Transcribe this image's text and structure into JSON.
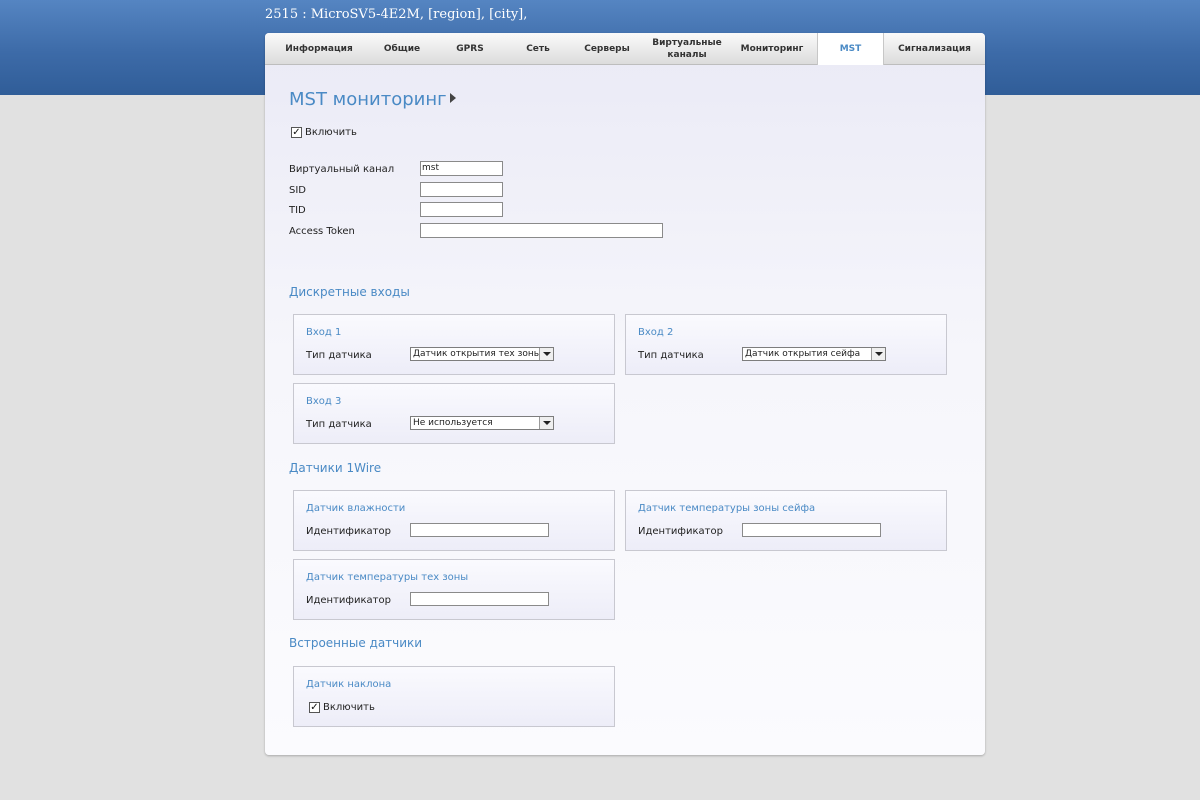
{
  "header": {
    "device_title": "2515 : MicroSV5-4E2M, [region], [city],"
  },
  "tabs": [
    {
      "label": "Информация",
      "active": false
    },
    {
      "label": "Общие",
      "active": false
    },
    {
      "label": "GPRS",
      "active": false
    },
    {
      "label": "Сеть",
      "active": false
    },
    {
      "label": "Серверы",
      "active": false
    },
    {
      "label": "Виртуальные каналы",
      "active": false
    },
    {
      "label": "Мониторинг",
      "active": false
    },
    {
      "label": "MST",
      "active": true
    },
    {
      "label": "Сигнализация",
      "active": false
    }
  ],
  "page": {
    "title": "MST мониторинг",
    "enable_label": "Включить",
    "enable_checked": true
  },
  "fields": {
    "virtual_channel": {
      "label": "Виртуальный канал",
      "value": "mst"
    },
    "sid": {
      "label": "SID",
      "value": ""
    },
    "tid": {
      "label": "TID",
      "value": ""
    },
    "access_token": {
      "label": "Access Token",
      "value": ""
    }
  },
  "discrete_inputs": {
    "title": "Дискретные входы",
    "sensor_type_label": "Тип датчика",
    "inputs": [
      {
        "title": "Вход 1",
        "selected": "Датчик открытия тех зоны"
      },
      {
        "title": "Вход 2",
        "selected": "Датчик открытия сейфа"
      },
      {
        "title": "Вход 3",
        "selected": "Не используется"
      }
    ]
  },
  "onewire": {
    "title": "Датчики 1Wire",
    "id_label": "Идентификатор",
    "sensors": [
      {
        "title": "Датчик влажности",
        "value": ""
      },
      {
        "title": "Датчик температуры зоны сейфа",
        "value": ""
      },
      {
        "title": "Датчик температуры тех зоны",
        "value": ""
      }
    ]
  },
  "builtin": {
    "title": "Встроенные датчики",
    "tilt": {
      "title": "Датчик наклона",
      "enable_label": "Включить",
      "checked": true
    }
  },
  "colors": {
    "accent": "#4a8ac5",
    "header_band": "#3d6ba8",
    "background": "#e1e1e1"
  },
  "icons": {
    "checkbox_checked": "checkmark-icon",
    "title_arrow": "caret-right-icon",
    "select_arrow": "chevron-down-icon"
  }
}
